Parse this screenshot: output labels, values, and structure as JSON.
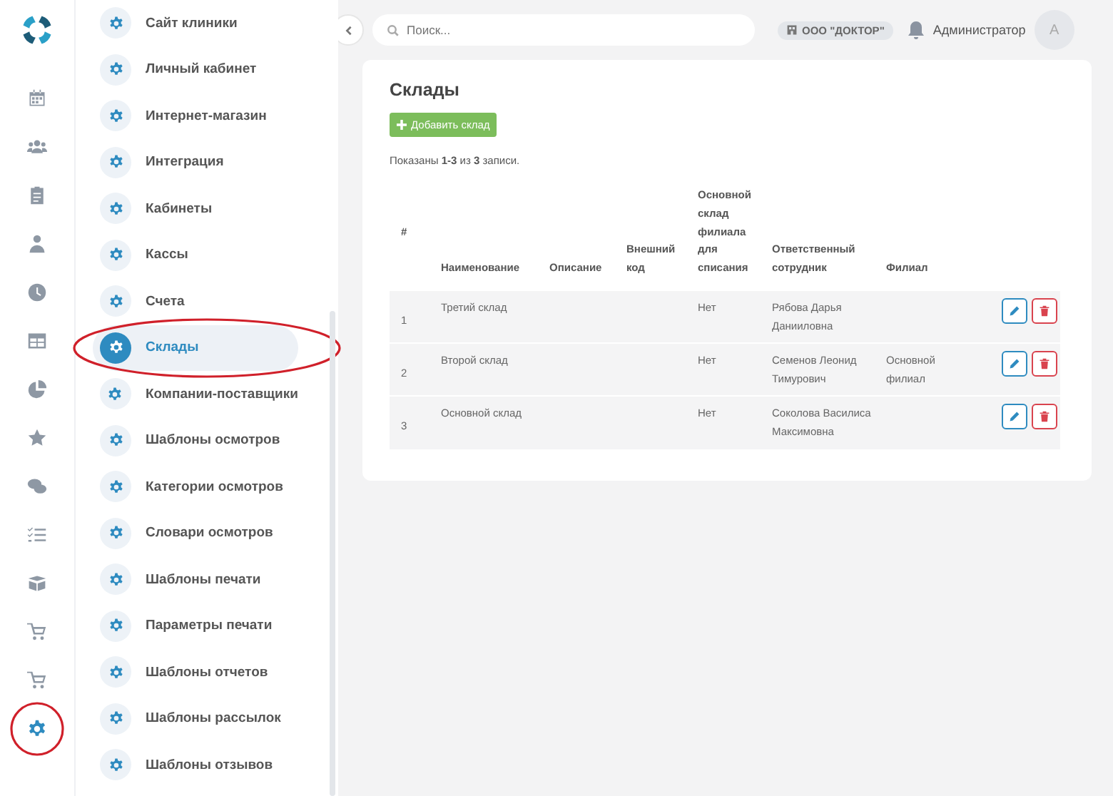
{
  "rail": [
    {
      "kind": "calendar",
      "selected": false
    },
    {
      "kind": "users",
      "selected": false
    },
    {
      "kind": "clipboard",
      "selected": false
    },
    {
      "kind": "person",
      "selected": false
    },
    {
      "kind": "clock",
      "selected": false
    },
    {
      "kind": "table",
      "selected": false
    },
    {
      "kind": "chart",
      "selected": false
    },
    {
      "kind": "star",
      "selected": false
    },
    {
      "kind": "chat",
      "selected": false
    },
    {
      "kind": "checklist",
      "selected": false
    },
    {
      "kind": "box",
      "selected": false
    },
    {
      "kind": "cart",
      "selected": false
    },
    {
      "kind": "cart",
      "selected": false
    },
    {
      "kind": "gear",
      "selected": true
    }
  ],
  "settings_menu": [
    {
      "label": "Сайт клиники",
      "selected": false
    },
    {
      "label": "Личный кабинет",
      "selected": false
    },
    {
      "label": "Интернет-магазин",
      "selected": false
    },
    {
      "label": "Интеграция",
      "selected": false
    },
    {
      "label": "Кабинеты",
      "selected": false
    },
    {
      "label": "Кассы",
      "selected": false
    },
    {
      "label": "Счета",
      "selected": false
    },
    {
      "label": "Склады",
      "selected": true
    },
    {
      "label": "Компании-поставщики",
      "selected": false
    },
    {
      "label": "Шаблоны осмотров",
      "selected": false
    },
    {
      "label": "Категории осмотров",
      "selected": false
    },
    {
      "label": "Словари осмотров",
      "selected": false
    },
    {
      "label": "Шаблоны печати",
      "selected": false
    },
    {
      "label": "Параметры печати",
      "selected": false
    },
    {
      "label": "Шаблоны отчетов",
      "selected": false
    },
    {
      "label": "Шаблоны рассылок",
      "selected": false
    },
    {
      "label": "Шаблоны отзывов",
      "selected": false
    }
  ],
  "topbar": {
    "search": {
      "placeholder": "Поиск..."
    },
    "organization": "ООО \"ДОКТОР\"",
    "user_name": "Администратор",
    "avatar_letter": "А"
  },
  "page": {
    "title": "Склады",
    "add_button": "Добавить склад",
    "summary": "Показаны **1-3** из **3** записи.",
    "table": {
      "columns": [
        "#",
        "Наименование",
        "Описание",
        "Внешний код",
        "Основной склад филиала для списания",
        "Ответственный сотрудник",
        "Филиал"
      ],
      "rows": [
        {
          "cells": [
            "1",
            "Третий склад",
            "",
            "",
            "Нет",
            "Рябова Дарья Данииловна",
            ""
          ]
        },
        {
          "cells": [
            "2",
            "Второй склад",
            "",
            "",
            "Нет",
            "Семенов Леонид Тимурович",
            "Основной филиал"
          ]
        },
        {
          "cells": [
            "3",
            "Основной склад",
            "",
            "",
            "Нет",
            "Соколова Василиса Максимовна",
            ""
          ]
        }
      ]
    }
  }
}
